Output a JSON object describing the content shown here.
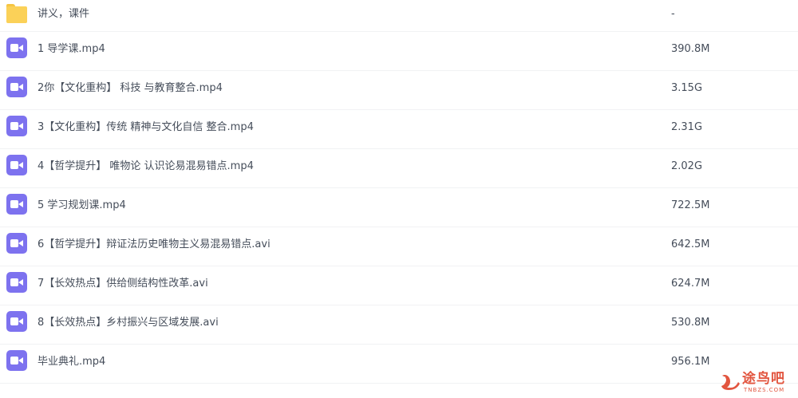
{
  "files": [
    {
      "type": "folder",
      "icon": "folder-icon",
      "name": "讲义，课件",
      "size": "-"
    },
    {
      "type": "video",
      "icon": "video-file-icon",
      "name": "1 导学课.mp4",
      "size": "390.8M"
    },
    {
      "type": "video",
      "icon": "video-file-icon",
      "name": "2你【文化重构】 科技 与教育整合.mp4",
      "size": "3.15G"
    },
    {
      "type": "video",
      "icon": "video-file-icon",
      "name": "3【文化重构】传统 精神与文化自信 整合.mp4",
      "size": "2.31G"
    },
    {
      "type": "video",
      "icon": "video-file-icon",
      "name": "4【哲学提升】 唯物论 认识论易混易错点.mp4",
      "size": "2.02G"
    },
    {
      "type": "video",
      "icon": "video-file-icon",
      "name": "5 学习规划课.mp4",
      "size": "722.5M"
    },
    {
      "type": "video",
      "icon": "video-file-icon",
      "name": "6【哲学提升】辩证法历史唯物主义易混易错点.avi",
      "size": "642.5M"
    },
    {
      "type": "video",
      "icon": "video-file-icon",
      "name": "7【长效热点】供给侧结构性改革.avi",
      "size": "624.7M"
    },
    {
      "type": "video",
      "icon": "video-file-icon",
      "name": "8【长效热点】乡村振兴与区域发展.avi",
      "size": "530.8M"
    },
    {
      "type": "video",
      "icon": "video-file-icon",
      "name": "毕业典礼.mp4",
      "size": "956.1M"
    }
  ],
  "watermark": {
    "text": "途鸟吧",
    "subtext": "TNBZS.COM",
    "color": "#e2553f"
  },
  "colors": {
    "folder": "#fbd158",
    "video_icon": "#7d72ef",
    "text": "#454d5a",
    "divider": "#f1f2f4"
  }
}
